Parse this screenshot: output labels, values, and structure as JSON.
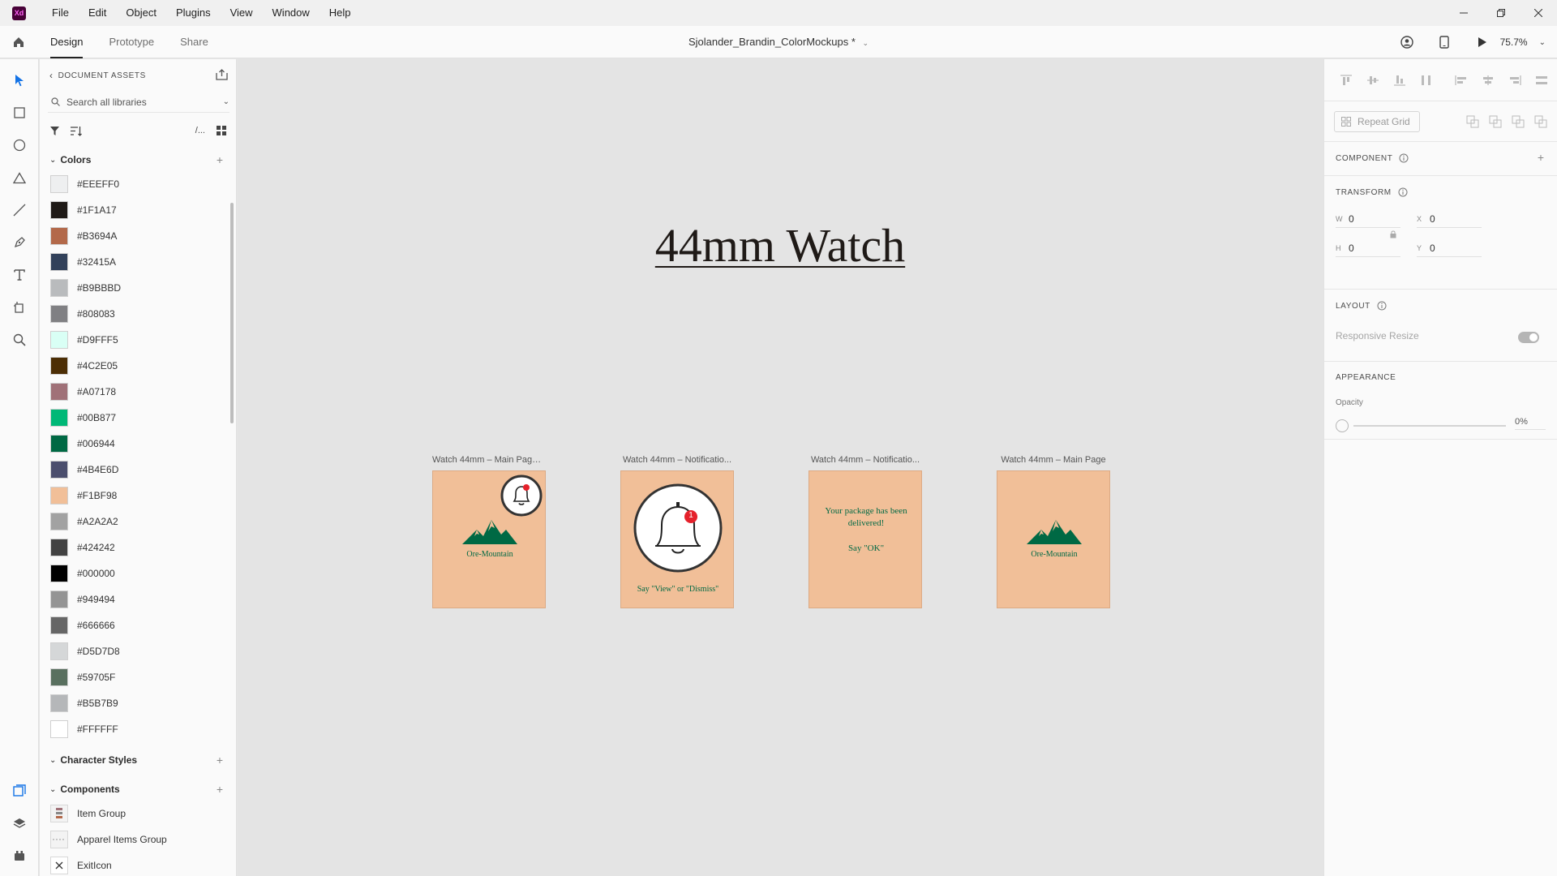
{
  "titlebar": {
    "logo": "Xd",
    "menu": [
      "File",
      "Edit",
      "Object",
      "Plugins",
      "View",
      "Window",
      "Help"
    ]
  },
  "topbar": {
    "tabs": [
      "Design",
      "Prototype",
      "Share"
    ],
    "active_tab": "Design",
    "document_title": "Sjolander_Brandin_ColorMockups *",
    "zoom": "75.7%"
  },
  "assets": {
    "header": "DOCUMENT ASSETS",
    "search_placeholder": "Search all libraries",
    "view_toggle_text": "/...",
    "colors_title": "Colors",
    "colors": [
      {
        "label": "#EEEFF0",
        "hex": "#EEEFF0"
      },
      {
        "label": "#1F1A17",
        "hex": "#1F1A17"
      },
      {
        "label": "#B3694A",
        "hex": "#B3694A"
      },
      {
        "label": "#32415A",
        "hex": "#32415A"
      },
      {
        "label": "#B9BBBD",
        "hex": "#B9BBBD"
      },
      {
        "label": "#808083",
        "hex": "#808083"
      },
      {
        "label": "#D9FFF5",
        "hex": "#D9FFF5"
      },
      {
        "label": "#4C2E05",
        "hex": "#4C2E05"
      },
      {
        "label": "#A07178",
        "hex": "#A07178"
      },
      {
        "label": "#00B877",
        "hex": "#00B877"
      },
      {
        "label": "#006944",
        "hex": "#006944"
      },
      {
        "label": "#4B4E6D",
        "hex": "#4B4E6D"
      },
      {
        "label": "#F1BF98",
        "hex": "#F1BF98"
      },
      {
        "label": "#A2A2A2",
        "hex": "#A2A2A2"
      },
      {
        "label": "#424242",
        "hex": "#424242"
      },
      {
        "label": "#000000",
        "hex": "#000000"
      },
      {
        "label": "#949494",
        "hex": "#949494"
      },
      {
        "label": "#666666",
        "hex": "#666666"
      },
      {
        "label": "#D5D7D8",
        "hex": "#D5D7D8"
      },
      {
        "label": "#59705F",
        "hex": "#59705F"
      },
      {
        "label": "#B5B7B9",
        "hex": "#B5B7B9"
      },
      {
        "label": "#FFFFFF",
        "hex": "#FFFFFF"
      }
    ],
    "char_styles_title": "Character Styles",
    "components_title": "Components",
    "components": [
      "Item Group",
      "Apparel Items Group",
      "ExitIcon"
    ]
  },
  "canvas": {
    "heading": "44mm Watch",
    "artboards": [
      {
        "label": "Watch 44mm – Main Page ...",
        "type": "main-notif",
        "brand": "Ore-Mountain"
      },
      {
        "label": "Watch 44mm – Notificatio...",
        "type": "bell",
        "badge": "1",
        "caption": "Say \"View\" or \"Dismiss\""
      },
      {
        "label": "Watch 44mm – Notificatio...",
        "type": "message",
        "message": "Your package has been delivered!",
        "caption": "Say \"OK\""
      },
      {
        "label": "Watch 44mm – Main Page",
        "type": "main",
        "brand": "Ore-Mountain"
      }
    ]
  },
  "properties": {
    "repeat_grid": "Repeat Grid",
    "component_title": "COMPONENT",
    "transform_title": "TRANSFORM",
    "transform": {
      "w": "0",
      "x": "0",
      "h": "0",
      "y": "0"
    },
    "layout_title": "LAYOUT",
    "responsive_resize": "Responsive Resize",
    "appearance_title": "APPEARANCE",
    "opacity_label": "Opacity",
    "opacity_value": "0%"
  },
  "theme": {
    "artboard_bg": "#F1BF98",
    "brand_green": "#006944",
    "badge_red": "#E5212B",
    "accent_blue": "#1473E6"
  }
}
